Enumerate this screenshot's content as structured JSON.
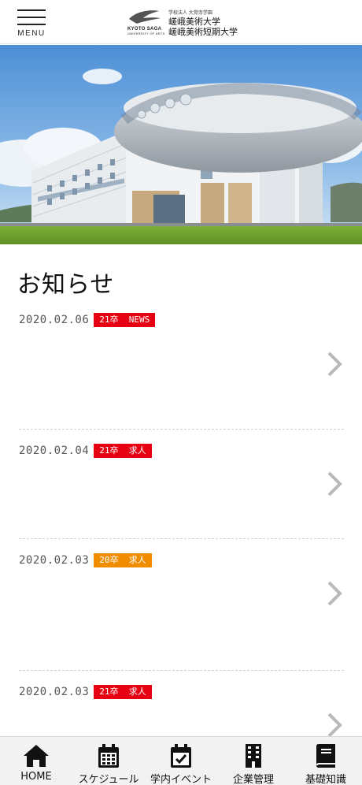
{
  "header": {
    "menu_label": "MENU",
    "logo": {
      "en_line1": "KYOTO SAGA",
      "en_line2": "UNIVERSITY OF ARTS",
      "corp": "学校法人 大覚寺学園",
      "name1": "嵯峨美術大学",
      "name2": "嵯峨美術短期大学"
    }
  },
  "news": {
    "title": "お知らせ",
    "items": [
      {
        "date": "2020.02.06",
        "tag": "21卒  NEWS",
        "tag_color": "#e60012"
      },
      {
        "date": "2020.02.04",
        "tag": "21卒  求人",
        "tag_color": "#e60012"
      },
      {
        "date": "2020.02.03",
        "tag": "20卒  求人",
        "tag_color": "#f08c00"
      },
      {
        "date": "2020.02.03",
        "tag": "21卒  求人",
        "tag_color": "#e60012"
      }
    ]
  },
  "bottom_nav": {
    "items": [
      {
        "label": "HOME",
        "icon": "home-icon"
      },
      {
        "label": "スケジュール",
        "icon": "calendar-icon"
      },
      {
        "label": "学内イベント",
        "icon": "calendar-check-icon"
      },
      {
        "label": "企業管理",
        "icon": "building-icon"
      },
      {
        "label": "基礎知識",
        "icon": "book-icon"
      }
    ]
  }
}
